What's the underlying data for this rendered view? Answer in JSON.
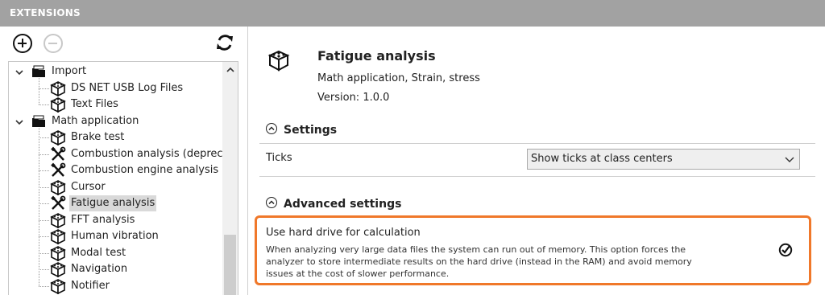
{
  "window": {
    "title": "EXTENSIONS"
  },
  "tree": {
    "items": [
      {
        "label": "Import",
        "level": 0,
        "type": "folder",
        "expanded": true
      },
      {
        "label": "DS NET USB Log Files",
        "level": 1,
        "type": "package"
      },
      {
        "label": "Text Files",
        "level": 1,
        "type": "package"
      },
      {
        "label": "Math application",
        "level": 0,
        "type": "folder",
        "expanded": true
      },
      {
        "label": "Brake test",
        "level": 1,
        "type": "package"
      },
      {
        "label": "Combustion analysis (deprecat",
        "level": 1,
        "type": "tools"
      },
      {
        "label": "Combustion engine analysis",
        "level": 1,
        "type": "tools"
      },
      {
        "label": "Cursor",
        "level": 1,
        "type": "package"
      },
      {
        "label": "Fatigue analysis",
        "level": 1,
        "type": "tools",
        "selected": true
      },
      {
        "label": "FFT analysis",
        "level": 1,
        "type": "package"
      },
      {
        "label": "Human vibration",
        "level": 1,
        "type": "package"
      },
      {
        "label": "Modal test",
        "level": 1,
        "type": "package"
      },
      {
        "label": "Navigation",
        "level": 1,
        "type": "package"
      },
      {
        "label": "Notifier",
        "level": 1,
        "type": "package"
      }
    ]
  },
  "details": {
    "title": "Fatigue analysis",
    "description": "Math application, Strain, stress",
    "version": "Version: 1.0.0",
    "settings": {
      "header": "Settings",
      "ticks_label": "Ticks",
      "ticks_value": "Show ticks at class centers"
    },
    "advanced": {
      "header": "Advanced settings",
      "hard_drive_title": "Use hard drive for calculation",
      "hard_drive_desc": "When analyzing very large data files the system can run out of memory. This option forces the analyzer to store intermediate results on the hard drive (instead in the RAM) and avoid memory issues at the cost of slower performance.",
      "hard_drive_checked": true
    }
  },
  "colors": {
    "titlebar": "#a2a2a2",
    "highlight": "#f0782a",
    "selection": "#d9d9d9"
  },
  "icons": [
    "add-icon",
    "remove-icon",
    "refresh-icon",
    "folder-icon",
    "package-icon",
    "tools-icon",
    "check-icon"
  ]
}
